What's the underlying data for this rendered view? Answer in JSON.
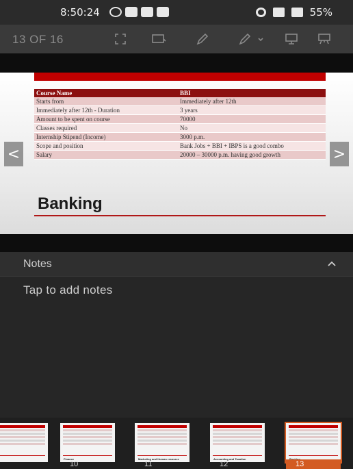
{
  "status_bar": {
    "time": "8:50:24",
    "battery": "55%",
    "app_icons": [
      "whatsapp-icon",
      "messenger-icon",
      "gallery-icon",
      "app-icon"
    ],
    "system_icons": [
      "alarm-icon",
      "volte-icon",
      "4g-signal-icon"
    ]
  },
  "toolbar": {
    "slide_counter": "13 OF 16",
    "icons": [
      "fullscreen-icon",
      "present-icon",
      "pen-icon",
      "ink-icon",
      "presenter-view-icon",
      "projector-icon"
    ]
  },
  "slide": {
    "table": {
      "headers": [
        "Course Name",
        "BBI"
      ],
      "rows": [
        [
          "Starts from",
          "Immediately after 12th"
        ],
        [
          "Immediately after 12th - Duration",
          "3 years"
        ],
        [
          "Amount to be spent on course",
          "70000"
        ],
        [
          "Classes required",
          "No"
        ],
        [
          "Internship Stipend (Income)",
          "3000 p.m."
        ],
        [
          "Scope and position",
          "Bank Jobs + BBI + IBPS is a good combo"
        ],
        [
          "Salary",
          "20000 – 30000 p.m. having good growth"
        ]
      ]
    },
    "title": "Banking",
    "accent_color": "#c00000"
  },
  "navigation": {
    "prev": "<",
    "next": ">"
  },
  "notes": {
    "label": "Notes",
    "placeholder": "Tap to add notes"
  },
  "thumbnails": [
    {
      "number": "",
      "caption": "",
      "active": false
    },
    {
      "number": "10",
      "caption": "Finance",
      "active": false
    },
    {
      "number": "11",
      "caption": "Marketing and Human resource",
      "active": false
    },
    {
      "number": "12",
      "caption": "Accounting and Taxation",
      "active": false
    },
    {
      "number": "13",
      "caption": "Banking",
      "active": true
    }
  ],
  "colors": {
    "active_thumb": "#d35b22",
    "background": "#262626"
  }
}
